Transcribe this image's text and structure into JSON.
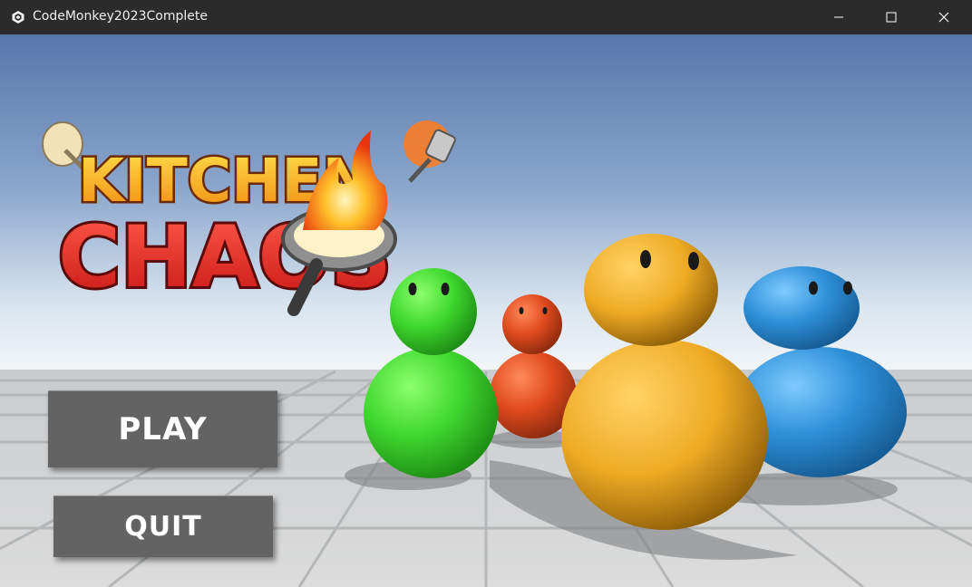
{
  "window": {
    "title": "CodeMonkey2023Complete",
    "app_icon": "unity-icon",
    "controls": [
      "minimize-icon",
      "maximize-icon",
      "close-icon"
    ]
  },
  "logo": {
    "line1": "KITCHEN",
    "line2": "CHAOS"
  },
  "menu": {
    "play_label": "PLAY",
    "quit_label": "QUIT"
  },
  "characters": [
    {
      "color": "#3fd82e"
    },
    {
      "color": "#e04a1e"
    },
    {
      "color": "#efaa24"
    },
    {
      "color": "#2e90d8"
    }
  ],
  "colors": {
    "sky_top": "#5a7ab0",
    "sky_horizon": "#eef3f7",
    "floor": "#d8d8d8",
    "button": "#636363",
    "titlebar": "#2b2b2b"
  }
}
